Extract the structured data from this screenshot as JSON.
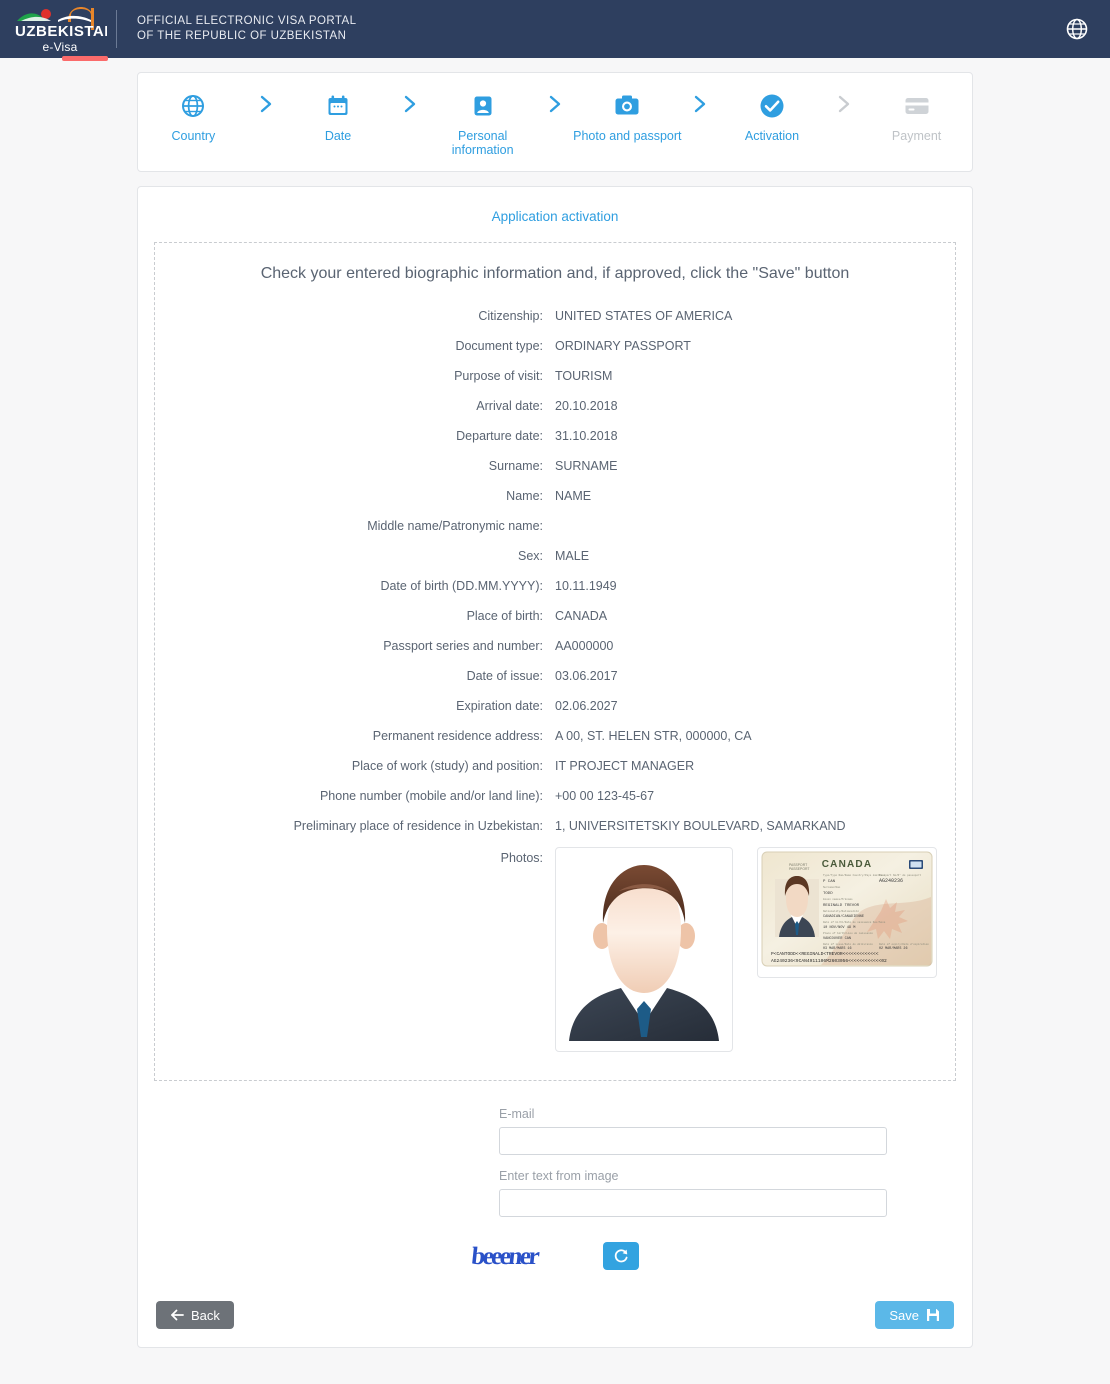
{
  "header": {
    "logo_text": "UZBEKISTAN",
    "logo_subtitle": "e-Visa",
    "portal_line1": "OFFICIAL ELECTRONIC VISA PORTAL",
    "portal_line2": "OF THE REPUBLIC OF UZBEKISTAN",
    "language_icon": "globe-icon",
    "background_color": "#2e3f5f",
    "accent_color": "#fb6b6b"
  },
  "stepper": {
    "steps": [
      {
        "label": "Country",
        "icon": "globe-icon",
        "state": "active"
      },
      {
        "label": "Date",
        "icon": "calendar-icon",
        "state": "active"
      },
      {
        "label": "Personal information",
        "icon": "person-card-icon",
        "state": "active"
      },
      {
        "label": "Photo and passport",
        "icon": "camera-icon",
        "state": "active"
      },
      {
        "label": "Activation",
        "icon": "check-circle-icon",
        "state": "current"
      },
      {
        "label": "Payment",
        "icon": "credit-card-icon",
        "state": "disabled"
      }
    ],
    "separator_icon": "chevron-right-icon",
    "active_color": "#2f9ee0",
    "disabled_color": "#bfc3c7"
  },
  "main": {
    "section_title": "Application activation",
    "panel_heading": "Check your entered biographic information and, if approved, click the \"Save\" button",
    "info_rows": [
      {
        "label": "Citizenship:",
        "value": "UNITED STATES OF AMERICA"
      },
      {
        "label": "Document type:",
        "value": "ORDINARY PASSPORT"
      },
      {
        "label": "Purpose of visit:",
        "value": "TOURISM"
      },
      {
        "label": "Arrival date:",
        "value": "20.10.2018"
      },
      {
        "label": "Departure date:",
        "value": "31.10.2018"
      },
      {
        "label": "Surname:",
        "value": "SURNAME"
      },
      {
        "label": "Name:",
        "value": "NAME"
      },
      {
        "label": "Middle name/Patronymic name:",
        "value": ""
      },
      {
        "label": "Sex:",
        "value": "MALE"
      },
      {
        "label": "Date of birth (DD.MM.YYYY):",
        "value": "10.11.1949"
      },
      {
        "label": "Place of birth:",
        "value": "CANADA"
      },
      {
        "label": "Passport series and number:",
        "value": "AA000000"
      },
      {
        "label": "Date of issue:",
        "value": "03.06.2017"
      },
      {
        "label": "Expiration date:",
        "value": "02.06.2027"
      },
      {
        "label": "Permanent residence address:",
        "value": "A 00, ST. HELEN STR, 000000, CA"
      },
      {
        "label": "Place of work (study) and position:",
        "value": "IT PROJECT MANAGER"
      },
      {
        "label": "Phone number (mobile and/or land line):",
        "value": "+00 00 123-45-67"
      },
      {
        "label": "Preliminary place of residence in Uzbekistan:",
        "value": "1, UNIVERSITETSKIY BOULEVARD, SAMARKAND"
      }
    ],
    "photos_label": "Photos:",
    "photos": [
      {
        "name": "applicant-portrait-photo",
        "alt": "portrait placeholder photo"
      },
      {
        "name": "passport-scan-photo",
        "alt": "CANADA passport data page",
        "country": "CANADA",
        "number": "AG240236"
      }
    ]
  },
  "form": {
    "email_label": "E-mail",
    "email_value": "",
    "email_placeholder": "",
    "captcha_label": "Enter text from image",
    "captcha_value": "",
    "captcha_placeholder": "",
    "captcha_text": "beeener",
    "captcha_refresh_icon": "refresh-icon"
  },
  "footer": {
    "back_label": "Back",
    "back_icon": "arrow-left-icon",
    "save_label": "Save",
    "save_icon": "floppy-disk-icon",
    "back_color": "#6d7278",
    "save_color": "#5bb8e8"
  }
}
